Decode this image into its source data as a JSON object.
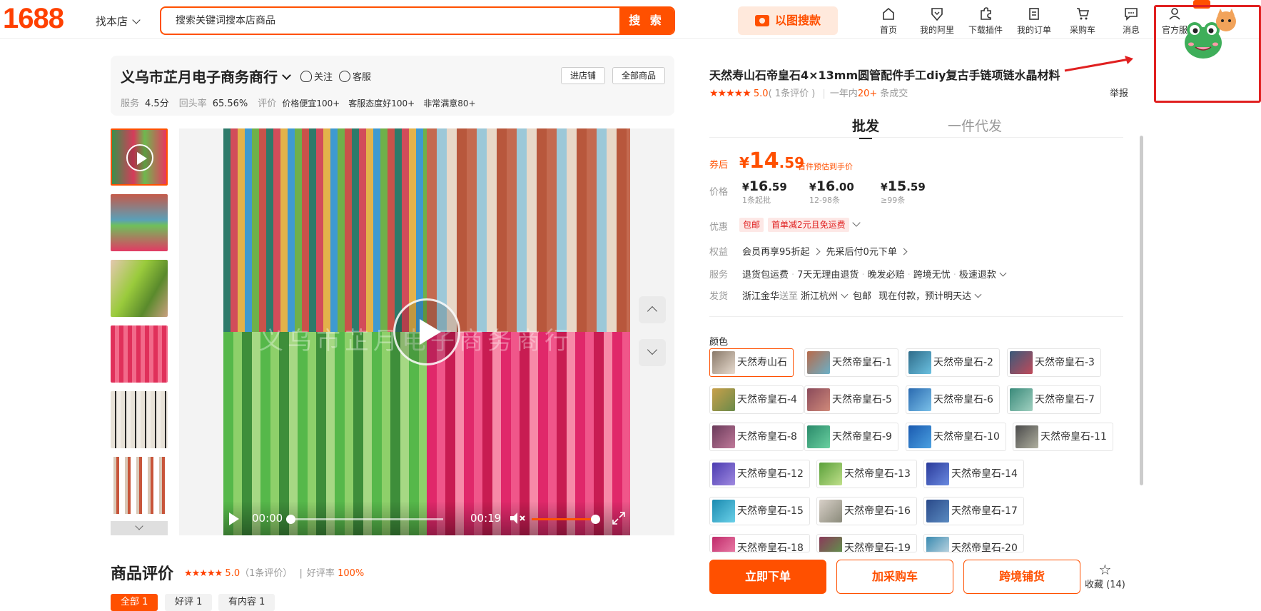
{
  "header": {
    "logo": "1688",
    "find_store": "找本店",
    "search_placeholder": "搜索关键词搜本店商品",
    "search_button": "搜 索",
    "image_search": "以图搜款",
    "nav": [
      {
        "label": "首页",
        "icon": "home-icon"
      },
      {
        "label": "我的阿里",
        "icon": "heart-shield-icon"
      },
      {
        "label": "下载插件",
        "icon": "puzzle-icon"
      },
      {
        "label": "我的订单",
        "icon": "clipboard-icon"
      },
      {
        "label": "采购车",
        "icon": "cart-icon"
      },
      {
        "label": "消息",
        "icon": "message-icon"
      },
      {
        "label": "官方服",
        "icon": "user-icon"
      }
    ],
    "accent": "#ff5000"
  },
  "shop": {
    "name": "义乌市芷月电子商务商行",
    "follow": "关注",
    "service": "客服",
    "enter_shop": "进店铺",
    "all_products": "全部商品",
    "stats": {
      "service_label": "服务",
      "service_value": "4.5分",
      "repurchase_label": "回头率",
      "repurchase_value": "65.56%",
      "review_label": "评价",
      "tags": [
        "价格便宜100+",
        "客服态度好100+",
        "非常满意80+"
      ]
    }
  },
  "video": {
    "watermark": "义乌市芷月电子商务商行",
    "current_time": "00:00",
    "duration": "00:19",
    "progress": 0.0,
    "volume": 1.0
  },
  "reviews": {
    "title": "商品评价",
    "stars": "★★★★★",
    "score": "5.0",
    "count_text": "（1条评价）",
    "divider": "|",
    "good_rate_label": "好评率",
    "good_rate": "100%",
    "tabs": [
      "全部 1",
      "好评 1",
      "有内容 1"
    ]
  },
  "product": {
    "title": "天然寿山石帝皇石4×13mm圆管配件手工diy复古手链项链水晶材料",
    "stars": "★★★★★",
    "score": "5.0",
    "review_count": "( 1条评价 )",
    "sales_prefix": "一年内",
    "sales_number": "20+",
    "sales_suffix": "条成交",
    "report": "举报",
    "tabs": [
      "批发",
      "一件代发"
    ],
    "coupon_label": "券后",
    "coupon_currency": "¥",
    "coupon_int": "14",
    "coupon_dec": ".59",
    "coupon_note": "首件预估到手价",
    "price_label": "价格",
    "tiers": [
      {
        "int": "16",
        "dec": ".59",
        "qty": "1条起批"
      },
      {
        "int": "16",
        "dec": ".00",
        "qty": "12-98条"
      },
      {
        "int": "15",
        "dec": ".59",
        "qty": "≥99条"
      }
    ],
    "discount_label": "优惠",
    "discount_badges": [
      "包邮",
      "首单减2元且免运费"
    ],
    "benefit_label": "权益",
    "benefits": [
      "会员再享95折起",
      "先采后付0元下单"
    ],
    "service_label": "服务",
    "services": [
      "退货包运费",
      "7天无理由退货",
      "晚发必赔",
      "跨境无忧",
      "极速退款"
    ],
    "ship_label": "发货",
    "ship_from": "浙江金华",
    "ship_to_word": "送至",
    "ship_to": "浙江杭州",
    "ship_free": "包邮",
    "ship_eta": "现在付款，预计明天达",
    "color_label": "颜色",
    "colors": [
      "天然寿山石",
      "天然帝皇石-1",
      "天然帝皇石-2",
      "天然帝皇石-3",
      "天然帝皇石-4",
      "天然帝皇石-5",
      "天然帝皇石-6",
      "天然帝皇石-7",
      "天然帝皇石-8",
      "天然帝皇石-9",
      "天然帝皇石-10",
      "天然帝皇石-11",
      "天然帝皇石-12",
      "天然帝皇石-13",
      "天然帝皇石-14",
      "天然帝皇石-15",
      "天然帝皇石-16",
      "天然帝皇石-17",
      "天然帝皇石-18",
      "天然帝皇石-19",
      "天然帝皇石-20"
    ],
    "selected_color": "天然寿山石",
    "buy_now": "立即下单",
    "add_cart": "加采购车",
    "cross_border": "跨境铺货",
    "favorite": "收藏 (14)"
  }
}
